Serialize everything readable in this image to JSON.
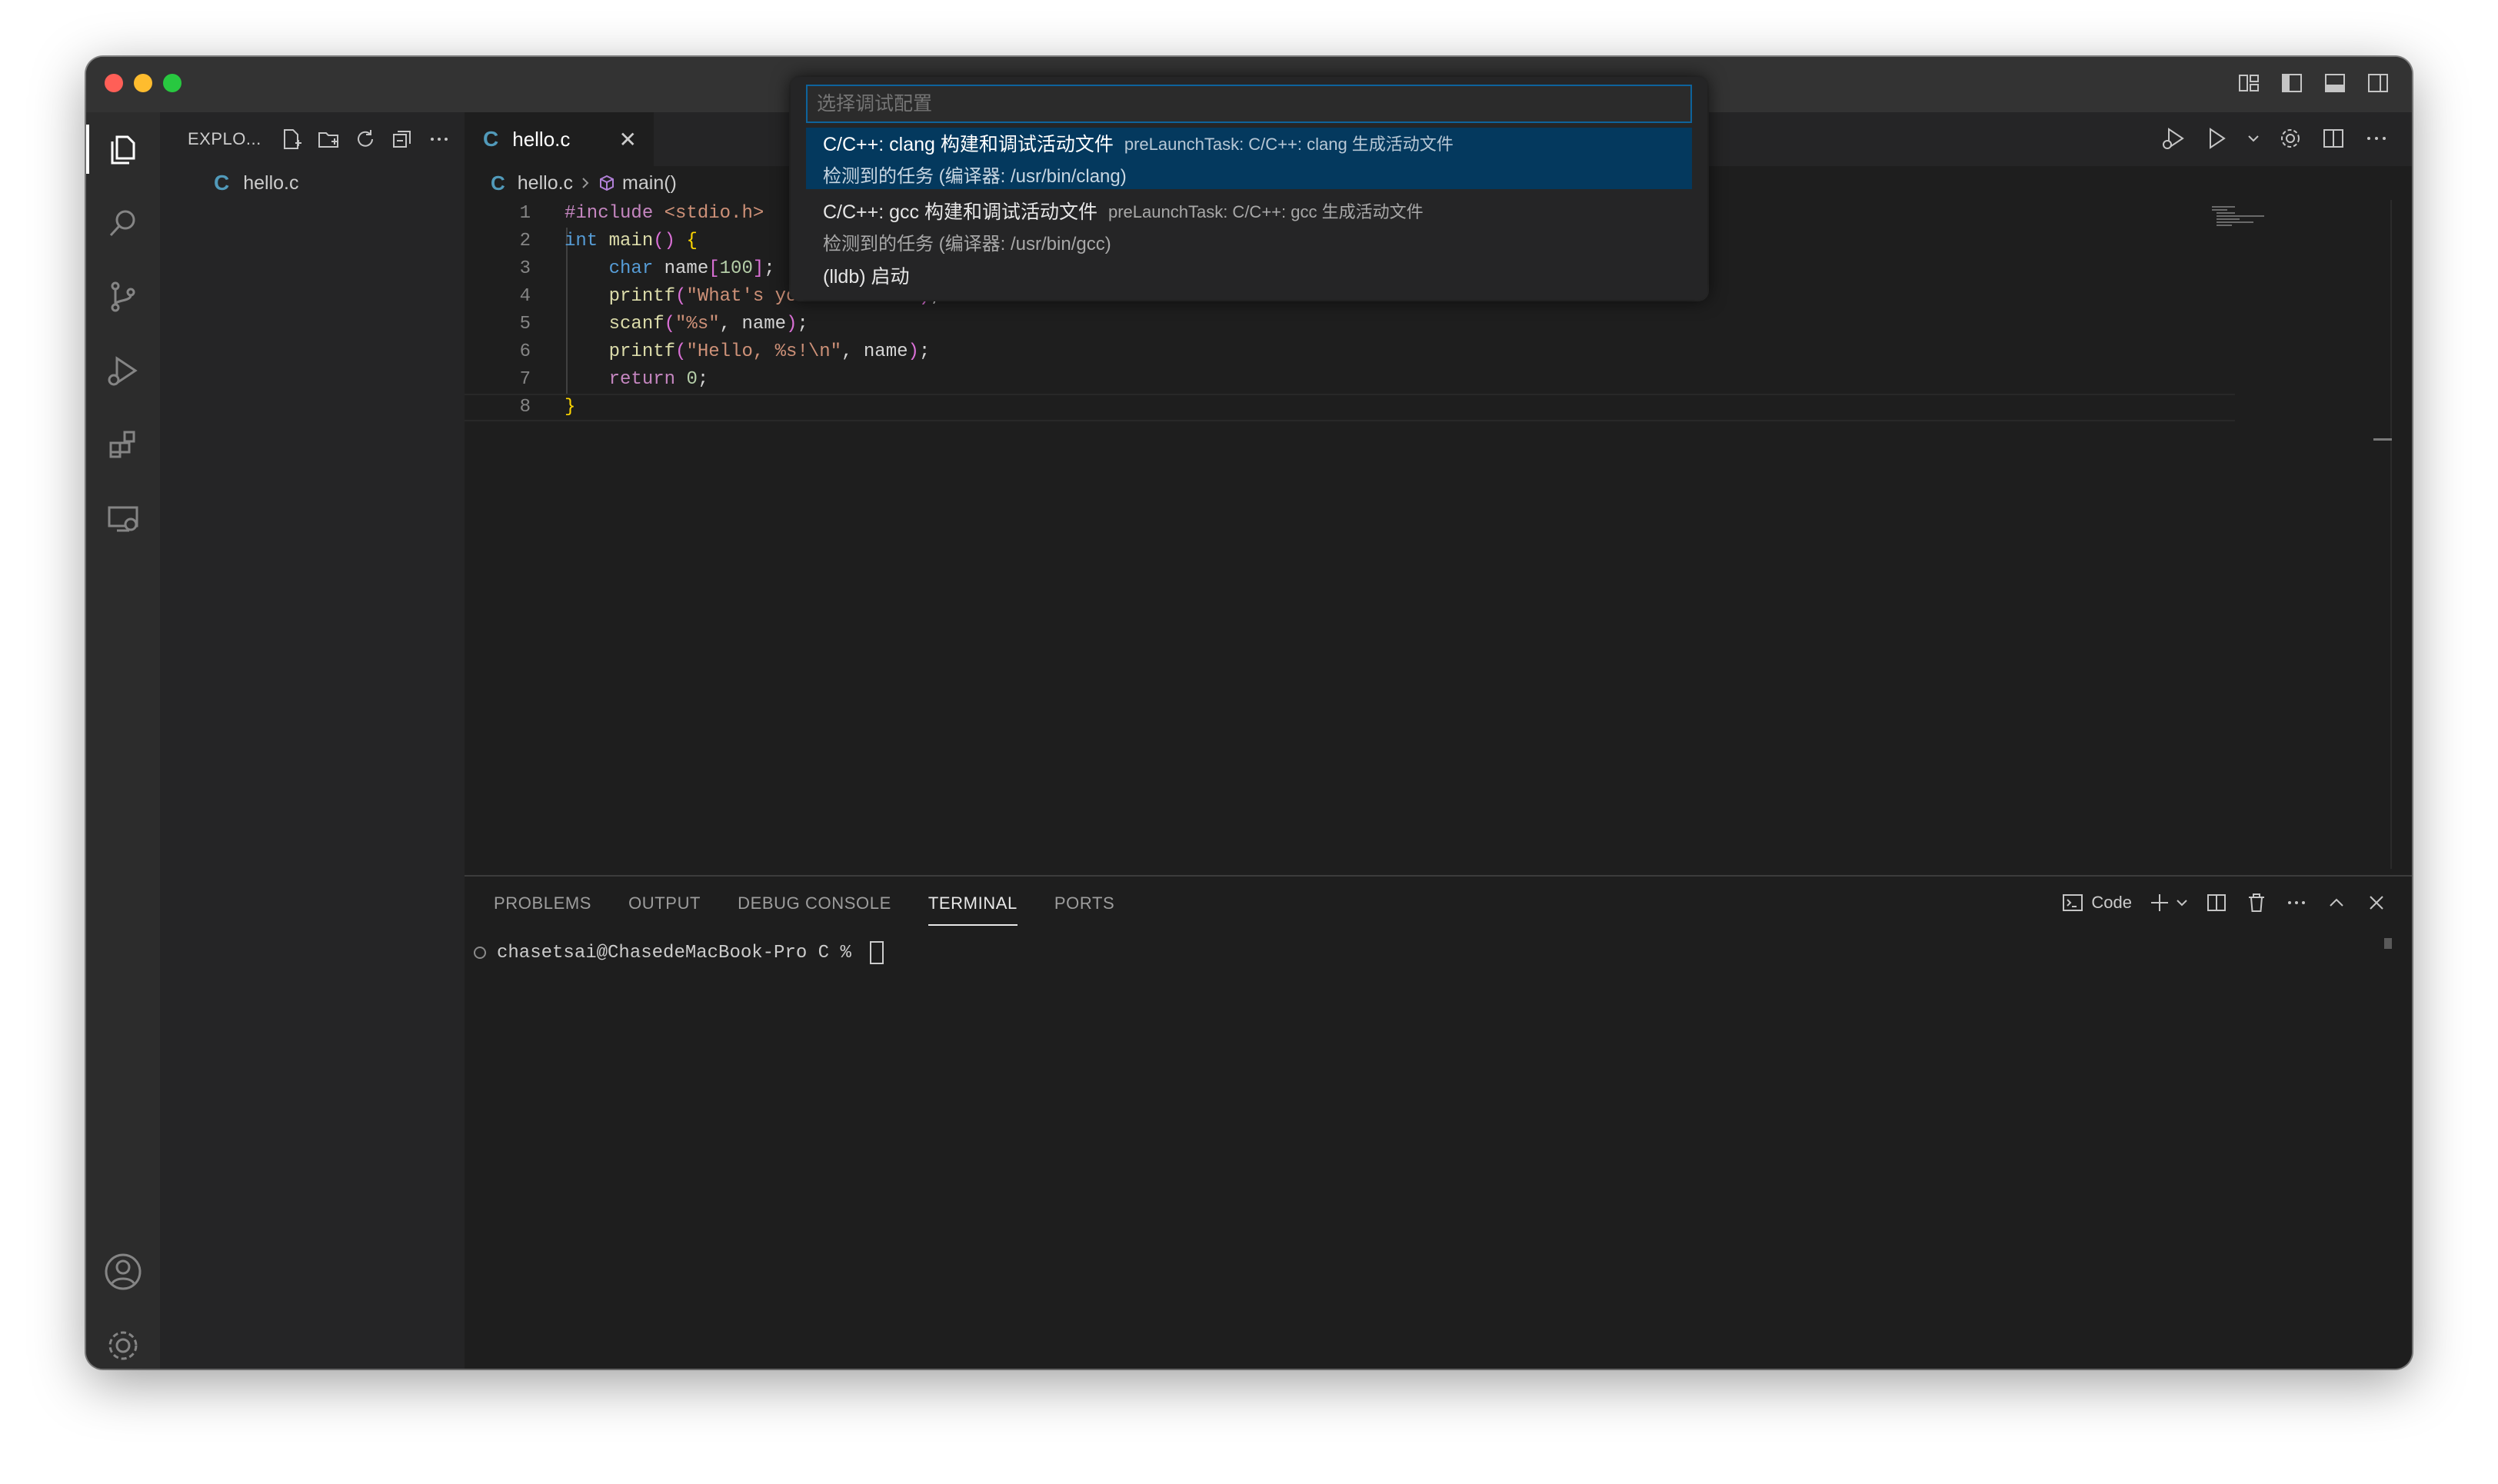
{
  "window": {
    "titlebar_icons": [
      "layout-customize-icon",
      "toggle-primary-sidebar-icon",
      "toggle-panel-icon",
      "toggle-secondary-sidebar-icon"
    ]
  },
  "activity_bar": {
    "items": [
      {
        "name": "explorer",
        "icon": "files-icon"
      },
      {
        "name": "search",
        "icon": "search-icon"
      },
      {
        "name": "source-control",
        "icon": "source-control-icon"
      },
      {
        "name": "run-and-debug",
        "icon": "run-debug-icon"
      },
      {
        "name": "extensions",
        "icon": "extensions-icon"
      },
      {
        "name": "remote-explorer",
        "icon": "remote-explorer-icon"
      }
    ],
    "bottom": [
      {
        "name": "accounts",
        "icon": "account-icon"
      },
      {
        "name": "manage",
        "icon": "gear-icon"
      }
    ]
  },
  "sidebar": {
    "title": "EXPLO...",
    "files": [
      {
        "icon_letter": "C",
        "name": "hello.c"
      }
    ]
  },
  "editor": {
    "tab": {
      "icon_letter": "C",
      "label": "hello.c",
      "close": "✕"
    },
    "breadcrumb": {
      "file": "hello.c",
      "symbol": "main()"
    },
    "lines": [
      {
        "n": "1",
        "text": "#include <stdio.h>"
      },
      {
        "n": "2",
        "text": "int main() {"
      },
      {
        "n": "3",
        "text": "    char name[100];"
      },
      {
        "n": "4",
        "text": "    printf(\"What's your name?\\n\");"
      },
      {
        "n": "5",
        "text": "    scanf(\"%s\", name);"
      },
      {
        "n": "6",
        "text": "    printf(\"Hello, %s!\\n\", name);"
      },
      {
        "n": "7",
        "text": "    return 0;"
      },
      {
        "n": "8",
        "text": "}"
      }
    ]
  },
  "quick_pick": {
    "placeholder": "选择调试配置",
    "items": [
      {
        "label": "C/C++: clang 构建和调试活动文件",
        "description": "preLaunchTask: C/C++: clang 生成活动文件",
        "detail": "检测到的任务 (编译器: /usr/bin/clang)",
        "selected": true
      },
      {
        "label": "C/C++: gcc 构建和调试活动文件",
        "description": "preLaunchTask: C/C++: gcc 生成活动文件",
        "detail": "检测到的任务 (编译器: /usr/bin/gcc)",
        "selected": false
      },
      {
        "label": "(lldb) 启动",
        "description": "",
        "detail": "",
        "selected": false
      }
    ]
  },
  "panel": {
    "tabs": [
      "PROBLEMS",
      "OUTPUT",
      "DEBUG CONSOLE",
      "TERMINAL",
      "PORTS"
    ],
    "active_tab": "TERMINAL",
    "terminal_name": "Code",
    "terminal_prompt": "chasetsai@ChasedeMacBook-Pro C % "
  },
  "colors": {
    "accent": "#0e639c",
    "selection": "#04395e",
    "c_icon": "#519aba"
  }
}
